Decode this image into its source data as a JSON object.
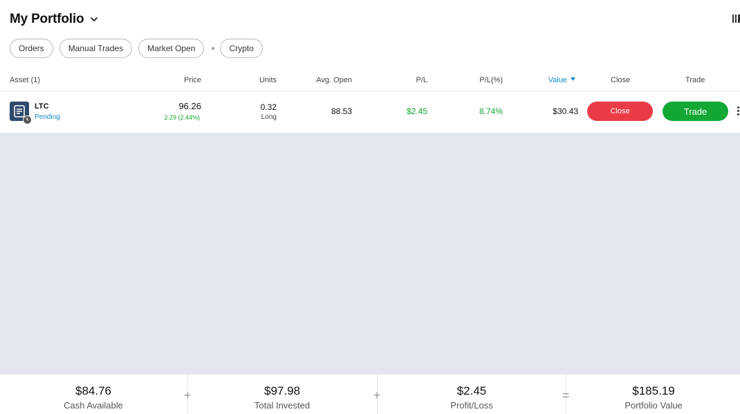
{
  "header": {
    "title": "My Portfolio"
  },
  "filters": [
    "Orders",
    "Manual Trades",
    "Market Open",
    "Crypto"
  ],
  "columns": {
    "asset": "Asset (1)",
    "price": "Price",
    "units": "Units",
    "avg_open": "Avg. Open",
    "pl": "P/L",
    "pl_pct": "P/L(%)",
    "value": "Value",
    "close": "Close",
    "trade": "Trade"
  },
  "row": {
    "symbol": "LTC",
    "status": "Pending",
    "price": "96.26",
    "price_change": "2.29 (2.44%)",
    "units": "0.32",
    "direction": "Long",
    "avg_open": "88.53",
    "pl": "$2.45",
    "pl_pct": "8.74%",
    "value": "$30.43",
    "close_label": "Close",
    "trade_label": "Trade"
  },
  "footer": {
    "cash": {
      "value": "$84.76",
      "label": "Cash Available"
    },
    "invested": {
      "value": "$97.98",
      "label": "Total Invested"
    },
    "profit": {
      "value": "$2.45",
      "label": "Profit/Loss"
    },
    "portfolio": {
      "value": "$185.19",
      "label": "Portfolio Value"
    },
    "op1": "+",
    "op2": "+",
    "op3": "="
  },
  "colors": {
    "positive": "#12a531",
    "accent_blue": "#1589c9",
    "close_button": "#ea3b46",
    "trade_button": "#13a836",
    "empty_area": "#e3e6ef"
  },
  "icons": {
    "title_dropdown": "chevron-down-icon",
    "value_sort": "sort-desc-caret-icon",
    "asset_logo": "ltc-logo-icon",
    "asset_status": "pending-clock-icon",
    "row_menu": "kebab-menu-icon",
    "corner": "layout-toggle-icon"
  }
}
